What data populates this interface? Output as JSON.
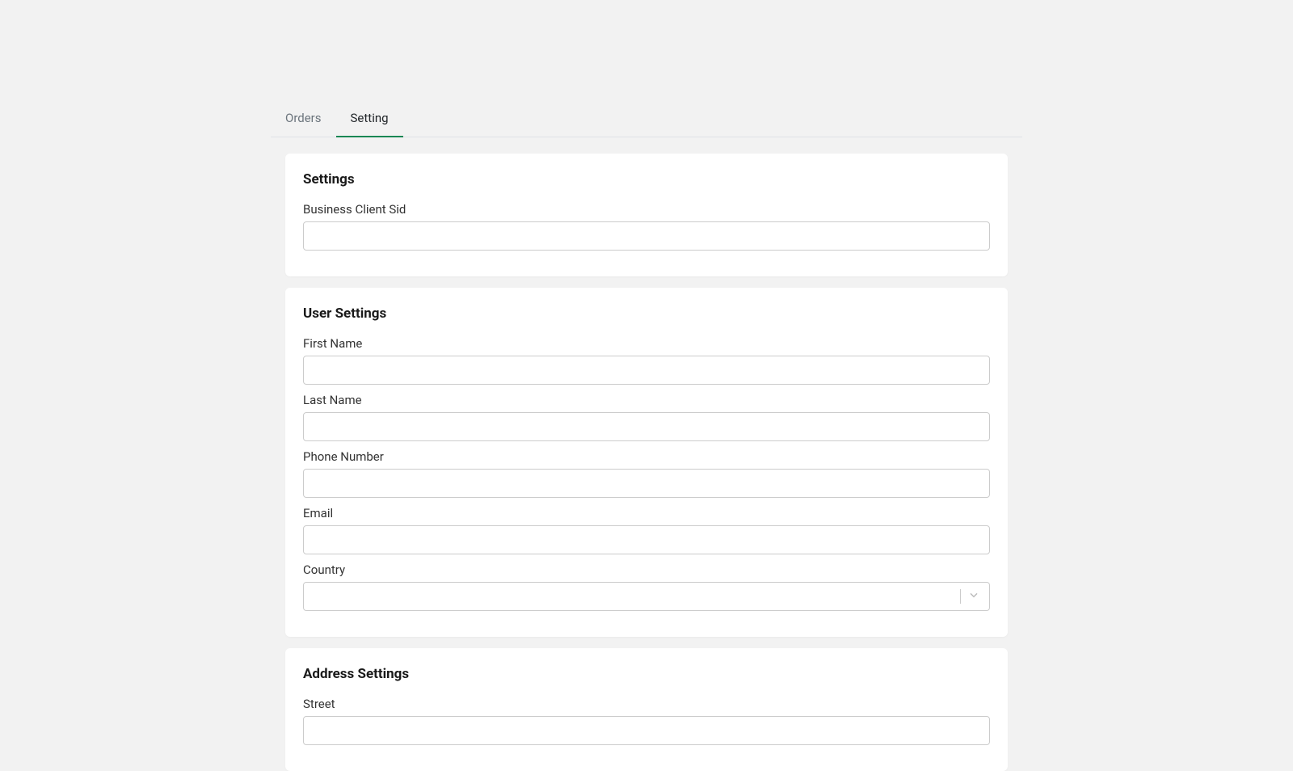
{
  "tabs": {
    "orders": "Orders",
    "setting": "Setting"
  },
  "colors": {
    "accent": "#198754"
  },
  "sections": {
    "settings": {
      "title": "Settings",
      "fields": {
        "business_client_sid": {
          "label": "Business Client Sid",
          "value": ""
        }
      }
    },
    "user_settings": {
      "title": "User Settings",
      "fields": {
        "first_name": {
          "label": "First Name",
          "value": ""
        },
        "last_name": {
          "label": "Last Name",
          "value": ""
        },
        "phone_number": {
          "label": "Phone Number",
          "value": ""
        },
        "email": {
          "label": "Email",
          "value": ""
        },
        "country": {
          "label": "Country",
          "value": ""
        }
      }
    },
    "address_settings": {
      "title": "Address Settings",
      "fields": {
        "street": {
          "label": "Street",
          "value": ""
        }
      }
    }
  }
}
